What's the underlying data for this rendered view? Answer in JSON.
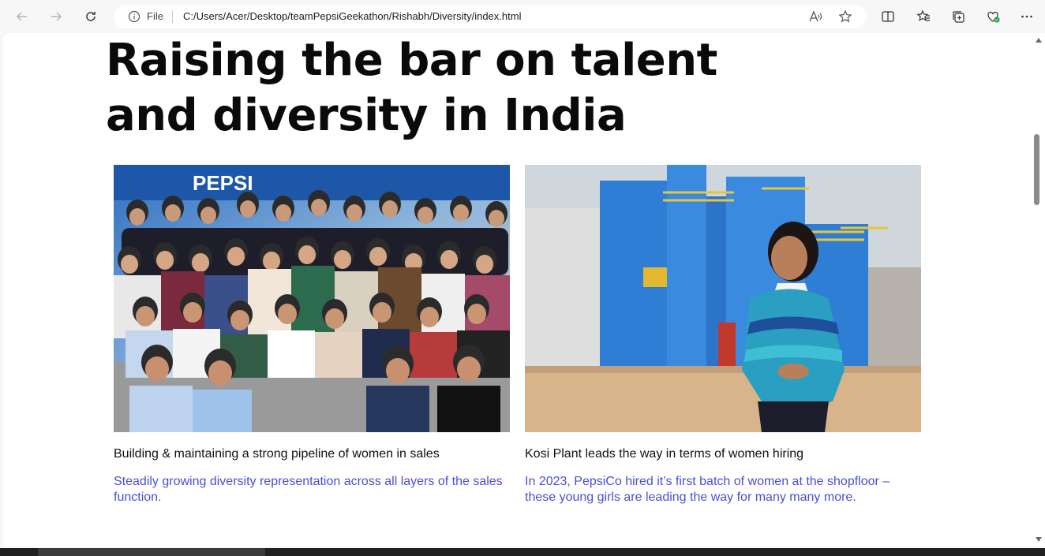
{
  "browser": {
    "file_label": "File",
    "url": "C:/Users/Acer/Desktop/teamPepsiGeekathon/Rishabh/Diversity/index.html",
    "icons": [
      "back-icon",
      "forward-icon",
      "refresh-icon",
      "info-icon",
      "read-aloud-icon",
      "favorite-star-icon",
      "split-screen-icon",
      "favorites-icon",
      "collections-icon",
      "browser-essentials-icon",
      "more-icon"
    ]
  },
  "page": {
    "headline": "Raising the bar on talent and diversity in India",
    "cards": [
      {
        "title": "Building & maintaining a strong pipeline of women in sales",
        "description": "Steadily growing diversity representation across all layers of the sales function.",
        "image_alt": "Group photo of women sales team members making a hand gesture"
      },
      {
        "title": "Kosi Plant leads the way in terms of women hiring",
        "description": "In 2023, PepsiCo hired it’s first batch of women at the shopfloor – these young girls are leading the way for many many more.",
        "image_alt": "Young woman standing in front of blue industrial tanks at plant"
      }
    ]
  },
  "colors": {
    "accent_text": "#4a4fd1",
    "headline": "#0a0a0a",
    "toolbar_bg": "#f7f7f7"
  }
}
